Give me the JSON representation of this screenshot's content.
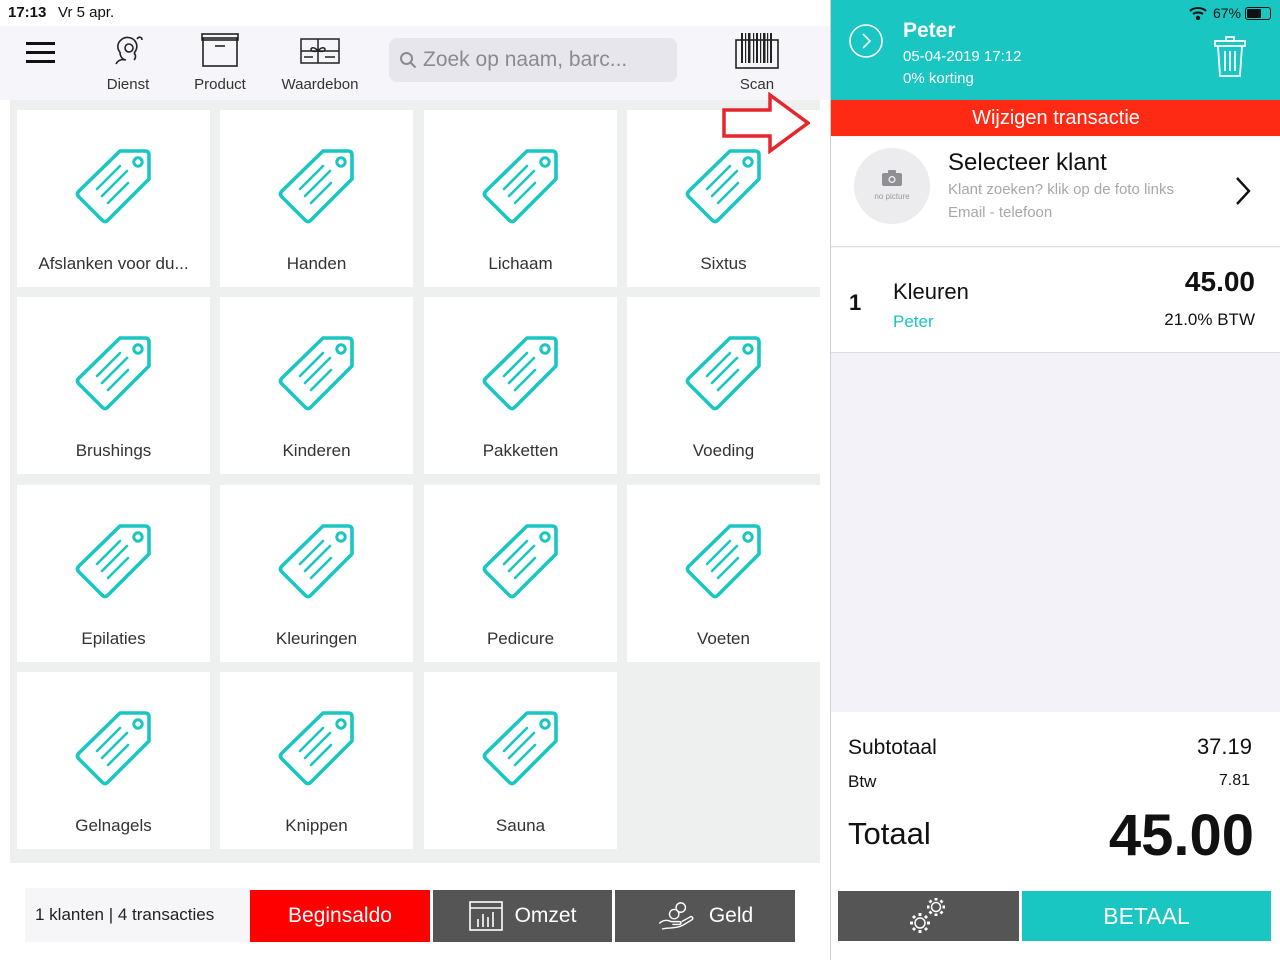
{
  "status": {
    "time": "17:13",
    "date": "Vr 5 apr.",
    "battery": "67%"
  },
  "toolbar": {
    "items": [
      {
        "label": "Dienst",
        "icon": "service-person-icon"
      },
      {
        "label": "Product",
        "icon": "product-box-icon"
      },
      {
        "label": "Waardebon",
        "icon": "gift-voucher-icon"
      }
    ],
    "search_placeholder": "Zoek op naam, barc...",
    "scan_label": "Scan"
  },
  "categories": [
    {
      "label": "Afslanken voor du..."
    },
    {
      "label": "Handen"
    },
    {
      "label": "Lichaam"
    },
    {
      "label": "Sixtus"
    },
    {
      "label": "Brushings"
    },
    {
      "label": "Kinderen"
    },
    {
      "label": "Pakketten"
    },
    {
      "label": "Voeding"
    },
    {
      "label": "Epilaties"
    },
    {
      "label": "Kleuringen"
    },
    {
      "label": "Pedicure"
    },
    {
      "label": "Voeten"
    },
    {
      "label": "Gelnagels"
    },
    {
      "label": "Knippen"
    },
    {
      "label": "Sauna"
    }
  ],
  "bottom": {
    "stats": "1 klanten | 4 transacties",
    "beginsaldo": "Beginsaldo",
    "omzet": "Omzet",
    "geld": "Geld"
  },
  "transaction": {
    "employee": "Peter",
    "datetime": "05-04-2019 17:12",
    "discount": "0% korting",
    "edit_banner": "Wijzigen transactie",
    "customer": {
      "title": "Selecteer klant",
      "hint": "Klant zoeken? klik op de foto links",
      "sub": "Email - telefoon",
      "avatar_text": "no picture"
    },
    "line_items": [
      {
        "qty": "1",
        "name": "Kleuren",
        "employee": "Peter",
        "price": "45.00",
        "tax": "21.0% BTW"
      }
    ],
    "totals": {
      "subtotal_label": "Subtotaal",
      "subtotal": "37.19",
      "btw_label": "Btw",
      "btw": "7.81",
      "total_label": "Totaal",
      "total": "45.00"
    },
    "pay_label": "BETAAL"
  },
  "colors": {
    "accent": "#1ac6c2",
    "danger": "#ff2a14",
    "dark_button": "#555555",
    "grid_bg": "#eef0f0"
  }
}
